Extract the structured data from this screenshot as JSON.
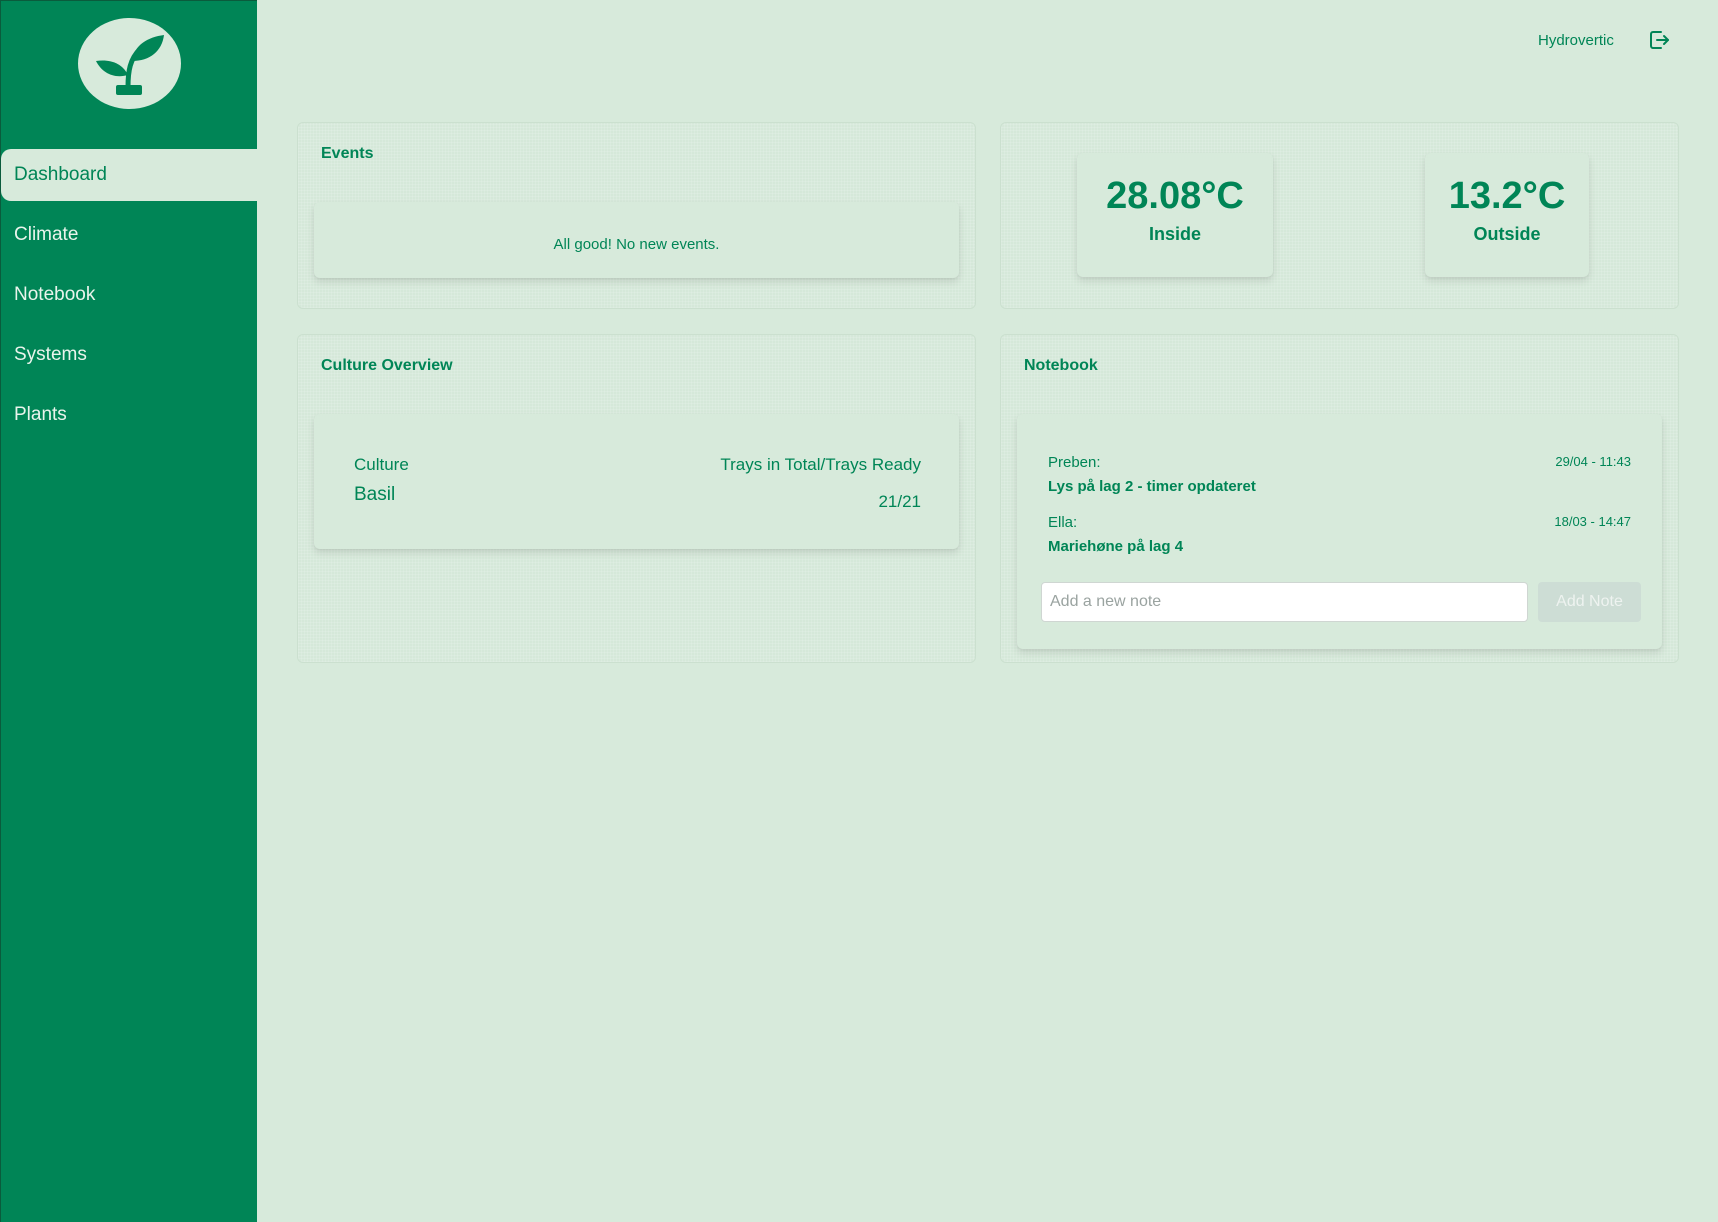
{
  "sidebar": {
    "logo_icon": "seedling-icon",
    "items": [
      {
        "label": "Dashboard",
        "active": true
      },
      {
        "label": "Climate",
        "active": false
      },
      {
        "label": "Notebook",
        "active": false
      },
      {
        "label": "Systems",
        "active": false
      },
      {
        "label": "Plants",
        "active": false
      }
    ]
  },
  "header": {
    "user": "Hydrovertic",
    "logout_icon": "logout-icon"
  },
  "events": {
    "title": "Events",
    "message": "All good! No new events."
  },
  "climate": {
    "inside": {
      "value": "28.08°C",
      "label": "Inside"
    },
    "outside": {
      "value": "13.2°C",
      "label": "Outside"
    }
  },
  "culture": {
    "title": "Culture Overview",
    "columns": [
      "Culture",
      "Trays in Total/Trays Ready"
    ],
    "rows": [
      {
        "name": "Basil",
        "trays": "21/21"
      }
    ]
  },
  "notebook": {
    "title": "Notebook",
    "notes": [
      {
        "author": "Preben:",
        "time": "29/04 - 11:43",
        "text": "Lys på lag 2 - timer opdateret"
      },
      {
        "author": "Ella:",
        "time": "18/03 - 14:47",
        "text": "Mariehøne på lag 4"
      }
    ],
    "input_placeholder": "Add a new note",
    "add_button": "Add Note"
  },
  "colors": {
    "primary": "#008556",
    "background": "#d7eadb",
    "sidebar_text": "#e9f4ec"
  }
}
